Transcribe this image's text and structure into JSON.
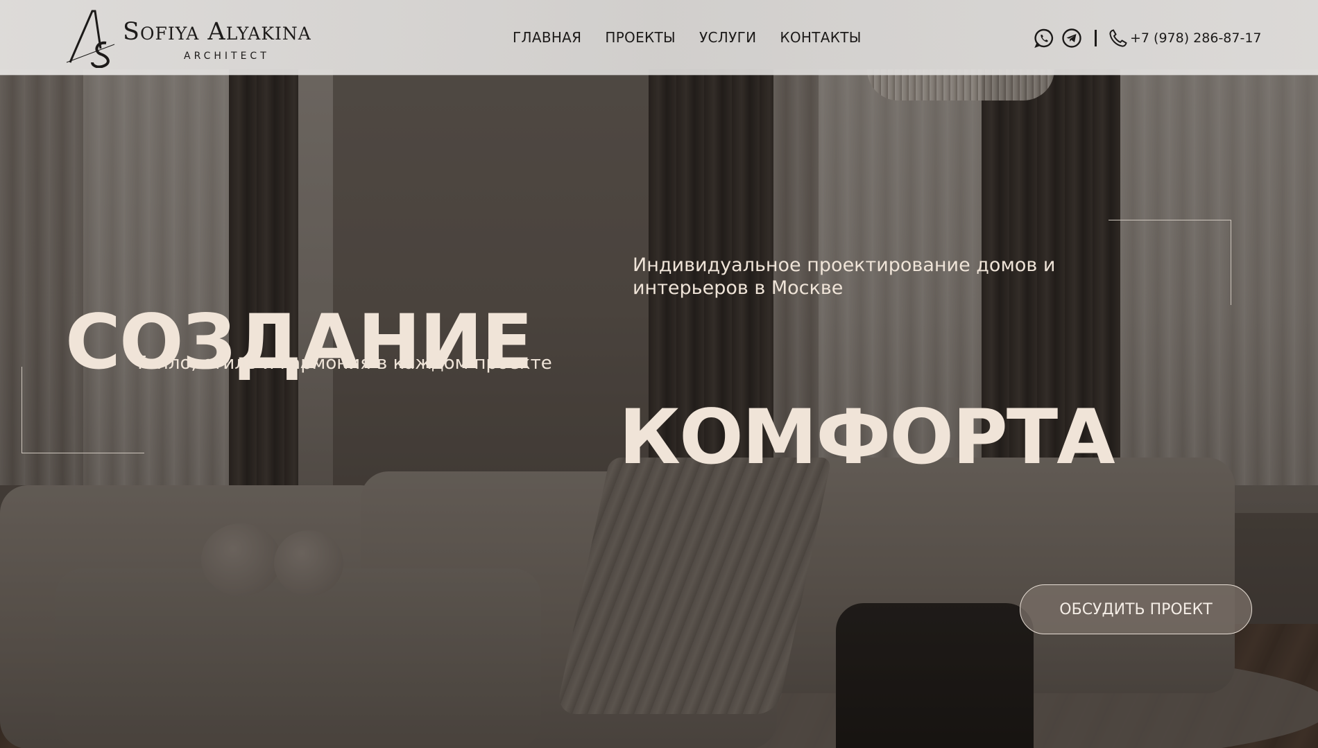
{
  "brand": {
    "name": "Sofiya Alyakina",
    "subtitle": "ARCHITECT",
    "monogram": "AS"
  },
  "nav": [
    {
      "label": "ГЛАВНАЯ"
    },
    {
      "label": "ПРОЕКТЫ"
    },
    {
      "label": "УСЛУГИ"
    },
    {
      "label": "КОНТАКТЫ"
    }
  ],
  "contacts": {
    "icons": [
      "whatsapp-icon",
      "telegram-icon",
      "phone-icon"
    ],
    "phone": "+7 (978) 286-87-17"
  },
  "hero": {
    "headline_line1": "СОЗДАНИЕ",
    "headline_line2": "КОМФОРТА",
    "subtitle_top": "Индивидуальное проектирование домов и интерьеров в Москве",
    "subtitle_mid": "Тепло, стиль и гармония в каждом проекте",
    "cta_label": "ОБСУДИТЬ ПРОЕКТ"
  },
  "colors": {
    "headline": "#f0e4d8",
    "header_bg": "#e4e2e0",
    "text_dark": "#1c1a19",
    "cta_bg": "#786e66"
  }
}
